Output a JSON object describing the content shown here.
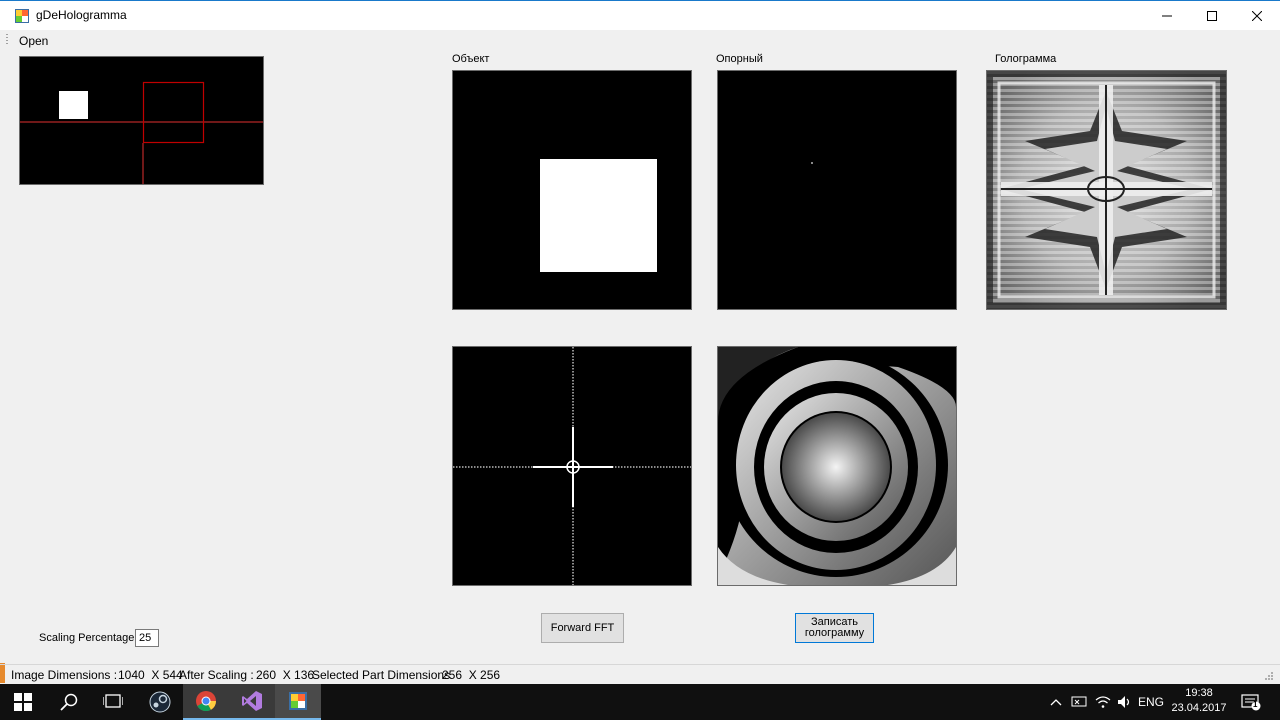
{
  "window": {
    "title": "gDeHologramma",
    "controls": {
      "minimize": "minimize-icon",
      "maximize": "maximize-icon",
      "close": "close-icon"
    }
  },
  "menu": {
    "open_label": "Open"
  },
  "panels": {
    "object_label": "Объект",
    "reference_label": "Опорный",
    "hologram_label": "Голограмма"
  },
  "controls": {
    "forward_fft_label": "Forward FFT",
    "record_hologram_line1": "Записать",
    "record_hologram_line2": "голограмму",
    "scaling_label": "Scaling Percentage",
    "scaling_value": "25"
  },
  "status": {
    "image_dims_label": "Image Dimensions :",
    "image_dims_value": "1040  X 544",
    "after_scaling_label": "After Scaling :",
    "after_scaling_value": "260  X 136",
    "selected_label": "Selected Part Dimensions",
    "selected_value": "256  X 256"
  },
  "taskbar": {
    "apps": [
      "start-icon",
      "search-icon",
      "task-view-icon",
      "steam-icon",
      "chrome-icon",
      "visual-studio-icon",
      "gdehologramma-app-icon"
    ],
    "language": "ENG",
    "time": "19:38",
    "date": "23.04.2017",
    "notifications": "1"
  },
  "colors": {
    "accent": "#0078d7",
    "selection_rect": "#c00000",
    "crosshair": "#e03030"
  }
}
